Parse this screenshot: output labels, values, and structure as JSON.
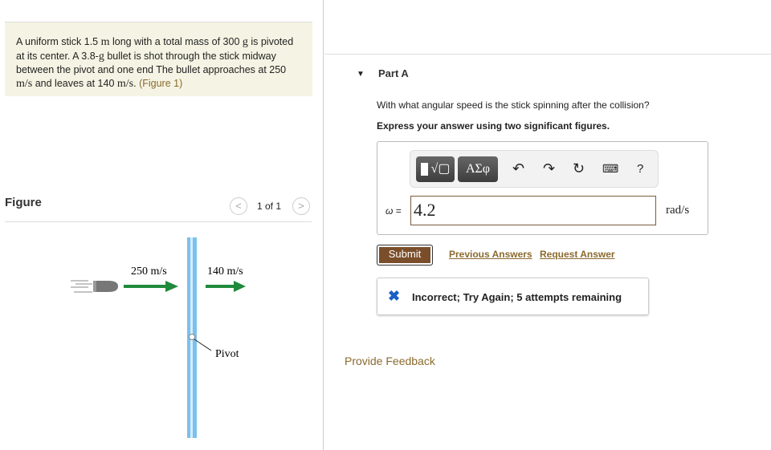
{
  "problem": {
    "t1": "A uniform stick 1.5 ",
    "u_m": "m",
    "t2": " long with a total mass of 300 ",
    "u_g": "g",
    "t3": " is pivoted at its center. A 3.8-",
    "u_g2": "g",
    "t4": " bullet is shot through the stick midway between the pivot and one end The bullet approaches at 250 ",
    "u_ms": "m/s",
    "t5": " and leaves at 140 ",
    "u_ms2": "m/s",
    "t6": ". ",
    "figure_link": "(Figure 1)"
  },
  "figure": {
    "title": "Figure",
    "pager": "1 of 1",
    "prev": "<",
    "next": ">",
    "v1": "250 m/s",
    "v2": "140 m/s",
    "pivot": "Pivot"
  },
  "part": {
    "label": "Part A",
    "question": "With what angular speed is the stick spinning after the collision?",
    "instruction": "Express your answer using two significant figures."
  },
  "toolbar": {
    "greek": "ΑΣφ",
    "help": "?"
  },
  "answer": {
    "var": "ω =",
    "value": "4.2",
    "unit": "rad/s"
  },
  "actions": {
    "submit": "Submit",
    "previous": "Previous Answers",
    "request": "Request Answer"
  },
  "result": {
    "text": "Incorrect; Try Again; 5 attempts remaining"
  },
  "feedback": "Provide Feedback"
}
